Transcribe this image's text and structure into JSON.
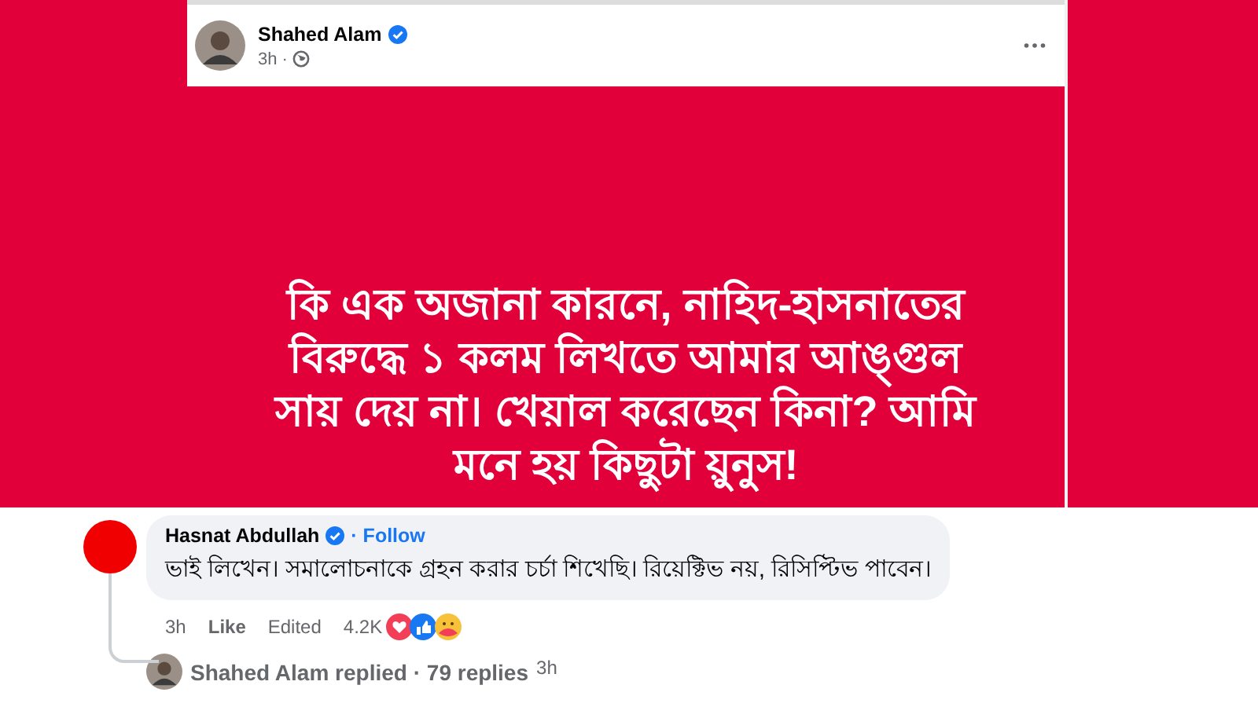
{
  "post": {
    "author": "Shahed Alam",
    "verified": true,
    "time": "3h ·",
    "text": "কি এক অজানা কারনে, নাহিদ-হাসনাতের বিরুদ্ধে ১ কলম লিখতে আমার আঙ্গুল সায় দেয় না। খেয়াল করেছেন কিনা? আমি মনে হয় কিছুটা য়ুনুস!"
  },
  "comment": {
    "author": "Hasnat Abdullah",
    "verified": true,
    "follow": "· Follow",
    "text": "ভাই লিখেন। সমালোচনাকে গ্রহন করার চর্চা শিখেছি। রিয়েক্টিভ নয়, রিসিপ্টিভ পাবেন।",
    "time": "3h",
    "like": "Like",
    "edited": "Edited",
    "reaction_count": "4.2K",
    "reply": {
      "text": "Shahed Alam replied · 79 replies",
      "time": "3h"
    }
  }
}
